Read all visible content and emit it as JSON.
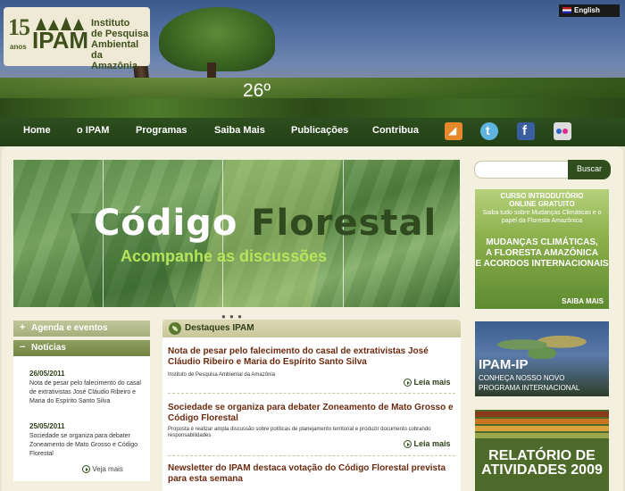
{
  "header": {
    "logo_15": "15",
    "logo_anos": "anos",
    "logo_ipam": "IPAM",
    "logo_line1": "Instituto",
    "logo_line2": "de Pesquisa",
    "logo_line3": "Ambiental",
    "logo_line4": "da Amazônia",
    "language": "English",
    "temperature": "26º"
  },
  "nav": {
    "items": [
      "Home",
      "o IPAM",
      "Programas",
      "Saiba Mais",
      "Publicações",
      "Contribua"
    ],
    "social": [
      "rss-icon",
      "twitter-icon",
      "facebook-icon",
      "flickr-icon"
    ]
  },
  "search": {
    "placeholder": "",
    "button": "Buscar"
  },
  "banner": {
    "title_part1": "Código",
    "title_part2": "Florestal",
    "subtitle": "Acompanhe as discussões",
    "dots": "● ● ●"
  },
  "sidebar": {
    "agenda_label": "Agenda e eventos",
    "noticias_label": "Notícias",
    "news": [
      {
        "date": "26/05/2011",
        "text": "Nota de pesar pelo falecimento do casal de extrativistas José Cláudio Ribeiro e Maria do Espírito Santo Silva"
      },
      {
        "date": "25/05/2011",
        "text": "Sociedade se organiza para debater Zoneamento de Mato Grosso e Código Florestal"
      }
    ],
    "more": "Veja mais"
  },
  "destaques": {
    "label": "Destaques IPAM",
    "items": [
      {
        "title": "Nota de pesar pelo falecimento do casal de extrativistas José Cláudio Ribeiro e Maria do Espírito Santo Silva",
        "source": "Instituto de Pesquisa Ambiental da Amazônia",
        "read_more": "Leia mais"
      },
      {
        "title": "Sociedade se organiza para debater Zoneamento de Mato Grosso e Código Florestal",
        "source": "Proposta é realizar ampla discussão sobre políticas de planejamento territorial e produzir documento cobrando responsabilidades",
        "read_more": "Leia mais"
      },
      {
        "title": "Newsletter do IPAM destaca votação do Código Florestal prevista para esta semana",
        "source": "",
        "read_more": ""
      }
    ]
  },
  "ads": {
    "curso_line1": "CURSO INTRODUTÓRIO",
    "curso_line2": "ONLINE GRATUITO",
    "curso_sub": "Saiba tudo sobre Mudanças Climáticas e o papel da Floresta Amazônica",
    "curso_big1": "MUDANÇAS CLIMÁTICAS,",
    "curso_big2": "A FLORESTA AMAZÔNICA",
    "curso_big3": "E ACORDOS INTERNACIONAIS",
    "curso_more": "SAIBA MAIS",
    "ipamip_title": "IPAM-IP",
    "ipamip_sub1": "CONHEÇA NOSSO NOVO",
    "ipamip_sub2": "PROGRAMA INTERNACIONAL",
    "relatorio_line1": "RELATÓRIO DE",
    "relatorio_line2": "ATIVIDADES 2009"
  },
  "colors": {
    "nav_bg": "#2d4f1e",
    "title_text": "#6b2a0f",
    "banner_subtitle": "#b5e55a"
  }
}
